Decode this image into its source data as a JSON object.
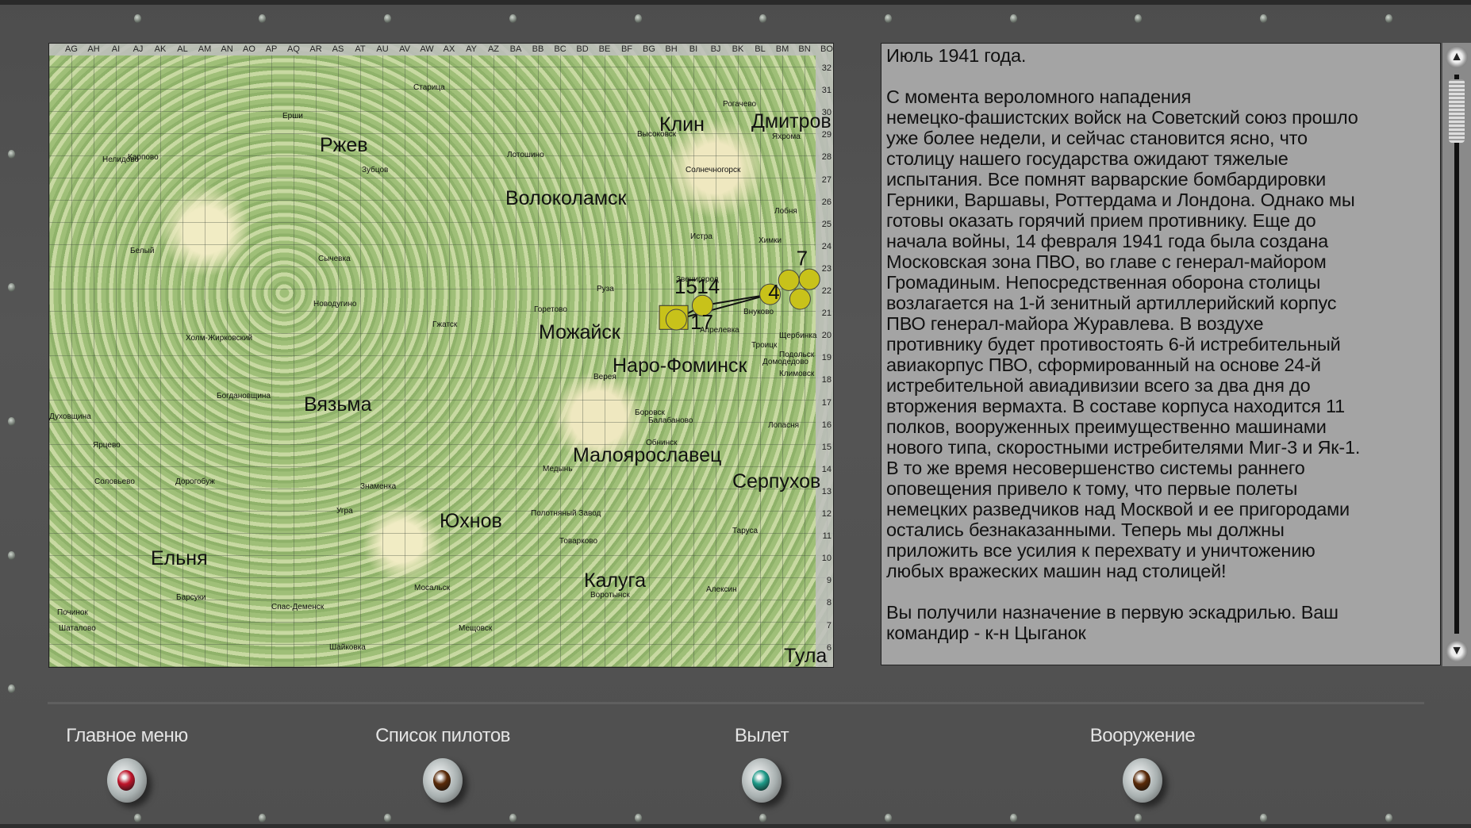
{
  "map": {
    "columns": [
      "AG",
      "AH",
      "AI",
      "AJ",
      "AK",
      "AL",
      "AM",
      "AN",
      "AO",
      "AP",
      "AQ",
      "AR",
      "AS",
      "AT",
      "AU",
      "AV",
      "AW",
      "AX",
      "AY",
      "AZ",
      "BA",
      "BB",
      "BC",
      "BD",
      "BE",
      "BF",
      "BG",
      "BH",
      "BI",
      "BJ",
      "BK",
      "BL",
      "BM",
      "BN",
      "BO"
    ],
    "rows": [
      "32",
      "31",
      "30",
      "29",
      "28",
      "27",
      "26",
      "25",
      "24",
      "23",
      "22",
      "21",
      "20",
      "19",
      "18",
      "17",
      "16",
      "15",
      "14",
      "13",
      "12",
      "11",
      "10",
      "9",
      "8",
      "7",
      "6"
    ],
    "major_cities": [
      "Ржев",
      "Клин",
      "Дмитров",
      "Волоколамск",
      "Можайск",
      "Наро-Фоминск",
      "Вязьма",
      "Малоярославец",
      "Серпухов",
      "Юхнов",
      "Ельня",
      "Калуга",
      "Тула"
    ],
    "towns": [
      "Старица",
      "Ерши",
      "Нелидово",
      "Карпово",
      "Зубцов",
      "Лотошино",
      "Высоковск",
      "Рогачево",
      "Яхрома",
      "Солнечногорск",
      "Лобня",
      "Истра",
      "Химки",
      "Белый",
      "Сычевка",
      "Звенигород",
      "Руза",
      "Новодугино",
      "Горетово",
      "Гжатск",
      "Холм-Жирковский",
      "Внуково",
      "Апрелевка",
      "Щербинка",
      "Троицк",
      "Подольск",
      "Домодедово",
      "Климовск",
      "Верея",
      "Богдановщина",
      "Духовщина",
      "Боровск",
      "Балабаново",
      "Лопасня",
      "Обнинск",
      "Ярцево",
      "Медынь",
      "Соловьево",
      "Дорогобуж",
      "Знаменка",
      "Угра",
      "Полотняный Завод",
      "Таруса",
      "Товарково",
      "Барсуки",
      "Спас-Деменск",
      "Мосальск",
      "Воротынск",
      "Алексин",
      "Починок",
      "Шаталово",
      "Мещовск",
      "Шайковка"
    ],
    "waypoints": [
      "15",
      "14",
      "17",
      "4",
      "7"
    ],
    "marker_color": "#c8c21a"
  },
  "briefing": {
    "text": "Июль 1941 года.\n\nС момента вероломного нападения\nнемецко-фашистских войск на Советский союз прошло\nуже более недели, и сейчас становится ясно, что\nстолицу нашего государства ожидают тяжелые\nиспытания. Все помнят варварские бомбардировки\nГерники, Варшавы, Роттердама и Лондона. Однако мы\nготовы оказать горячий прием противнику. Еще до\nначала войны, 14 февраля 1941 года была создана\nМосковская зона ПВО, во главе с генерал-майором\nГромадиным. Непосредственная оборона столицы\nвозлагается на 1-й зенитный артиллерийский корпус\nПВО генерал-майора Журавлева. В воздухе\nпротивнику будет противостоять 6-й истребительный\nавиакорпус ПВО, сформированный на основе 24-й\nистребительной авиадивизии всего за два дня до\nвторжения вермахта. В составе корпуса находится 11\nполков, вооруженных преимущественно машинами\nнового типа, скоростными истребителями Миг-3 и Як-1.\nВ то же время несовершенство системы раннего\nоповещения привело к тому, что первые полеты\nнемецких разведчиков над Москвой и ее пригородами\nостались безнаказанными. Теперь мы должны\nприложить все усилия к перехвату и уничтожению\nлюбых вражеских машин над столицей!\n\nВы получили назначение в первую эскадрилью. Ваш\nкомандир - к-н Цыганок",
    "scroll_up": "▲",
    "scroll_down": "▼"
  },
  "controls": [
    {
      "label": "Главное меню",
      "lamp_color": "#c0142a"
    },
    {
      "label": "Список пилотов",
      "lamp_color": "#5a2a08"
    },
    {
      "label": "Вылет",
      "lamp_color": "#1d9a88"
    },
    {
      "label": "Вооружение",
      "lamp_color": "#5a2a08"
    }
  ]
}
